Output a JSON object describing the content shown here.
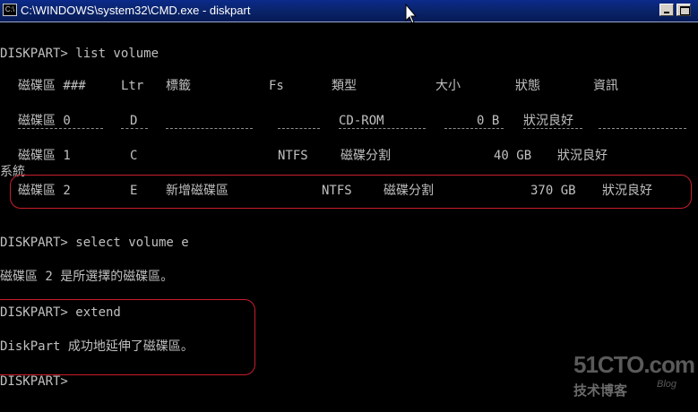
{
  "window": {
    "title": "C:\\WINDOWS\\system32\\CMD.exe - diskpart",
    "icon_label": "C:\\"
  },
  "console": {
    "cmd1": "DISKPART> list volume",
    "headers": {
      "volume": "磁碟區 ###",
      "ltr": "Ltr",
      "label": "標籤",
      "fs": "Fs",
      "type": "類型",
      "size": "大小",
      "status": "狀態",
      "info": "資訊"
    },
    "rows": [
      {
        "volume": "磁碟區 0",
        "ltr": "D",
        "label": "",
        "fs": "",
        "type": "CD-ROM",
        "size": "0 B",
        "status": "狀況良好",
        "info": ""
      },
      {
        "volume": "磁碟區 1",
        "ltr": "C",
        "label": "",
        "fs": "NTFS",
        "type": "磁碟分割",
        "size": "40 GB",
        "status": "狀況良好",
        "info": "系統"
      },
      {
        "volume": "磁碟區 2",
        "ltr": "E",
        "label": "新增磁碟區",
        "fs": "NTFS",
        "type": "磁碟分割",
        "size": "370 GB",
        "status": "狀況良好",
        "info": ""
      }
    ],
    "cmd2": "DISKPART> select volume e",
    "msg2": "磁碟區 2 是所選擇的磁碟區。",
    "cmd3": "DISKPART> extend",
    "msg3": "DiskPart 成功地延伸了磁碟區。",
    "prompt": "DISKPART>"
  },
  "watermark": {
    "site": "51CTO.com",
    "tagline": "技术博客",
    "blog": "Blog"
  },
  "colors": {
    "console_bg": "#000000",
    "console_text": "#c0c0c0",
    "highlight": "#c81e2a",
    "titlebar": "#0a246a"
  }
}
